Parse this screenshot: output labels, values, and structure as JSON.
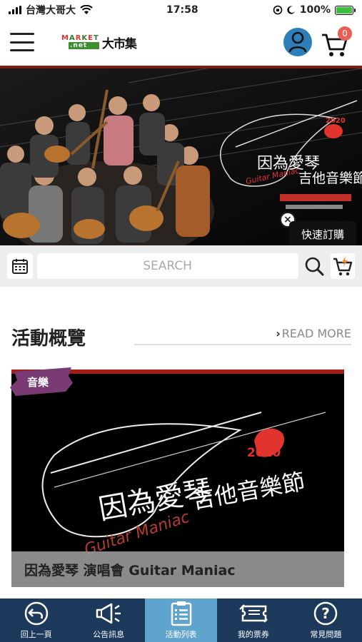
{
  "status": {
    "carrier": "台灣大哥大",
    "time": "17:58",
    "battery": "100%"
  },
  "header": {
    "logo_text": "大市集",
    "logo_top": "MARKET",
    "logo_bottom": ".net",
    "cart_count": "0"
  },
  "banner": {
    "title_main": "因為愛琴",
    "title_sub": "吉他音樂節",
    "title_en": "Guitar Maniac",
    "year": "2020"
  },
  "quick_order": {
    "label": "快速訂購",
    "close": "×"
  },
  "search": {
    "placeholder": "SEARCH"
  },
  "section": {
    "title": "活動概覽",
    "read_more": "READ MORE"
  },
  "event": {
    "tag": "音樂",
    "title": "因為愛琴 演唱會 Guitar Maniac",
    "poster_main": "因為愛琴",
    "poster_sub": "吉他音樂節",
    "poster_en": "Guitar Maniac",
    "year": "2020"
  },
  "nav": {
    "items": [
      {
        "label": "回上一頁",
        "icon": "back-arrow-icon"
      },
      {
        "label": "公告訊息",
        "icon": "megaphone-icon"
      },
      {
        "label": "活動列表",
        "icon": "list-icon"
      },
      {
        "label": "我的票券",
        "icon": "ticket-icon"
      },
      {
        "label": "常見問題",
        "icon": "question-icon"
      }
    ],
    "active_index": 2
  },
  "colors": {
    "nav_bg": "#1d3a5c",
    "nav_active": "#5ea4cc",
    "avatar": "#2d7fb9",
    "badge": "#e95e55",
    "tag": "#7a3a73",
    "accent_red": "#e0342c"
  }
}
